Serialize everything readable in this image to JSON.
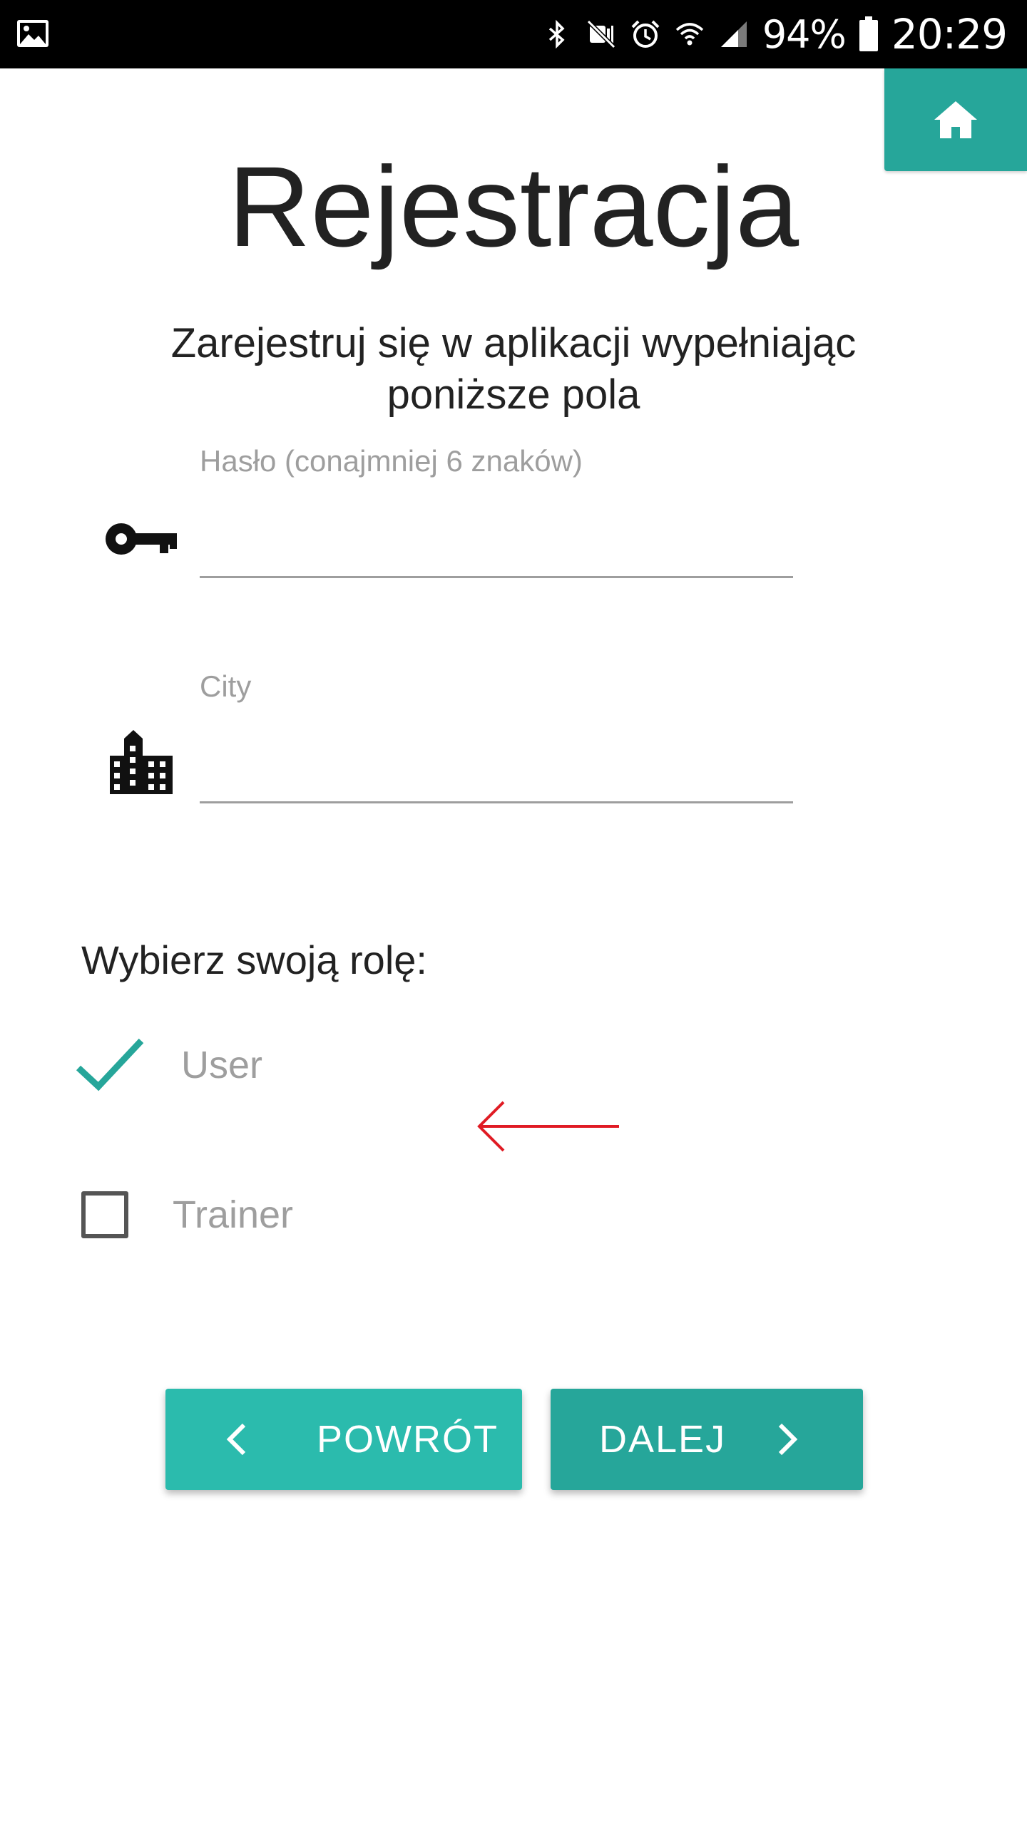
{
  "status_bar": {
    "battery": "94%",
    "time": "20:29",
    "icons": [
      "gallery-icon",
      "bluetooth-icon",
      "mute-icon",
      "alarm-icon",
      "wifi-icon",
      "signal-icon",
      "battery-icon"
    ]
  },
  "header": {
    "home_icon": "home-icon",
    "title": "Rejestracja",
    "subtitle": "Zarejestruj się w aplikacji wypełniając poniższe pola"
  },
  "form": {
    "password": {
      "label": "Hasło (conajmniej 6 znaków)",
      "value": "",
      "icon": "key-icon"
    },
    "city": {
      "label": "City",
      "value": "",
      "icon": "city-icon"
    }
  },
  "role": {
    "heading": "Wybierz swoją rolę:",
    "options": [
      {
        "label": "User",
        "checked": true
      },
      {
        "label": "Trainer",
        "checked": false
      }
    ]
  },
  "buttons": {
    "back_label": "POWRÓT",
    "next_label": "DALEJ"
  },
  "colors": {
    "accent": "#26a69a",
    "accent_light": "#2bbbad",
    "annotation_arrow": "#e01b24"
  }
}
